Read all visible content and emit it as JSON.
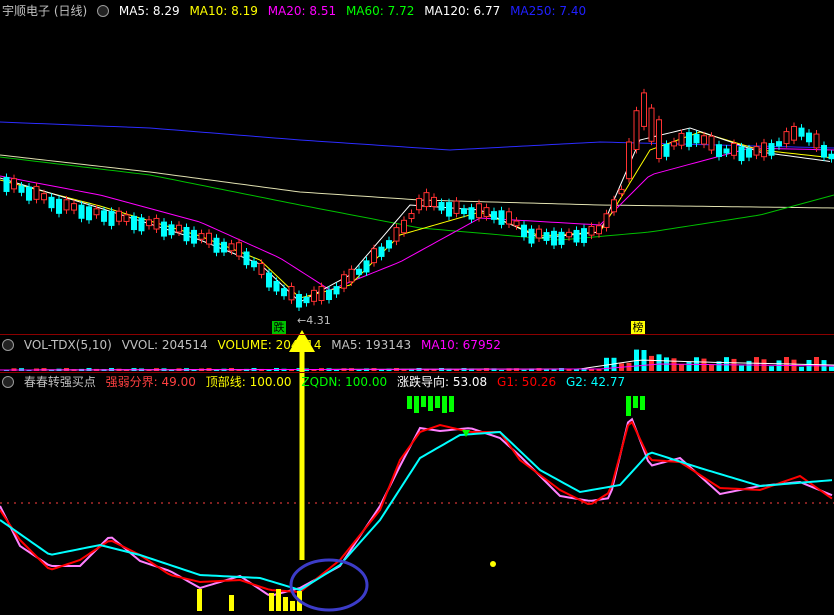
{
  "header": {
    "title": "宇顺电子 (日线)",
    "ma": [
      {
        "label": "MA5: 8.29",
        "color": "#ffffff"
      },
      {
        "label": "MA10: 8.19",
        "color": "#ffff00"
      },
      {
        "label": "MA20: 8.51",
        "color": "#ff00ff"
      },
      {
        "label": "MA60: 7.72",
        "color": "#00ff00"
      },
      {
        "label": "MA120: 6.77",
        "color": "#ffffff"
      },
      {
        "label": "MA250: 7.40",
        "color": "#0000ff"
      }
    ]
  },
  "price_panel": {
    "low_label": "4.31",
    "tag_left": "跌",
    "tag_right": "榜"
  },
  "vol_panel": {
    "items": [
      {
        "label": "VOL-TDX(5,10)",
        "color": "#c0c0c0"
      },
      {
        "label": "VVOL: 204514",
        "color": "#c0c0c0"
      },
      {
        "label": "VOLUME: 204514",
        "color": "#ffff00"
      },
      {
        "label": "MA5: 193143",
        "color": "#c0c0c0"
      },
      {
        "label": "MA10: 67952",
        "color": "#ff00ff"
      }
    ]
  },
  "ind_panel": {
    "items": [
      {
        "label": "春春转强买点",
        "color": "#c0c0c0"
      },
      {
        "label": "强弱分界: 49.00",
        "color": "#ff4040"
      },
      {
        "label": "顶部线: 100.00",
        "color": "#ffff00"
      },
      {
        "label": "ZQDN: 100.00",
        "color": "#00ff00"
      },
      {
        "label": "涨跌导向: 53.08",
        "color": "#ffffff"
      },
      {
        "label": "G1: 50.26",
        "color": "#ff0000"
      },
      {
        "label": "G2: 42.77",
        "color": "#00ffff"
      }
    ]
  },
  "colors": {
    "up": "#ff3232",
    "down": "#00ffff",
    "divider": "#8b0000",
    "g1": "#ff0000",
    "g2": "#00ffff",
    "pink": "#ff80ff",
    "arrow": "#ffff00",
    "circle": "#3c3cc8"
  }
}
